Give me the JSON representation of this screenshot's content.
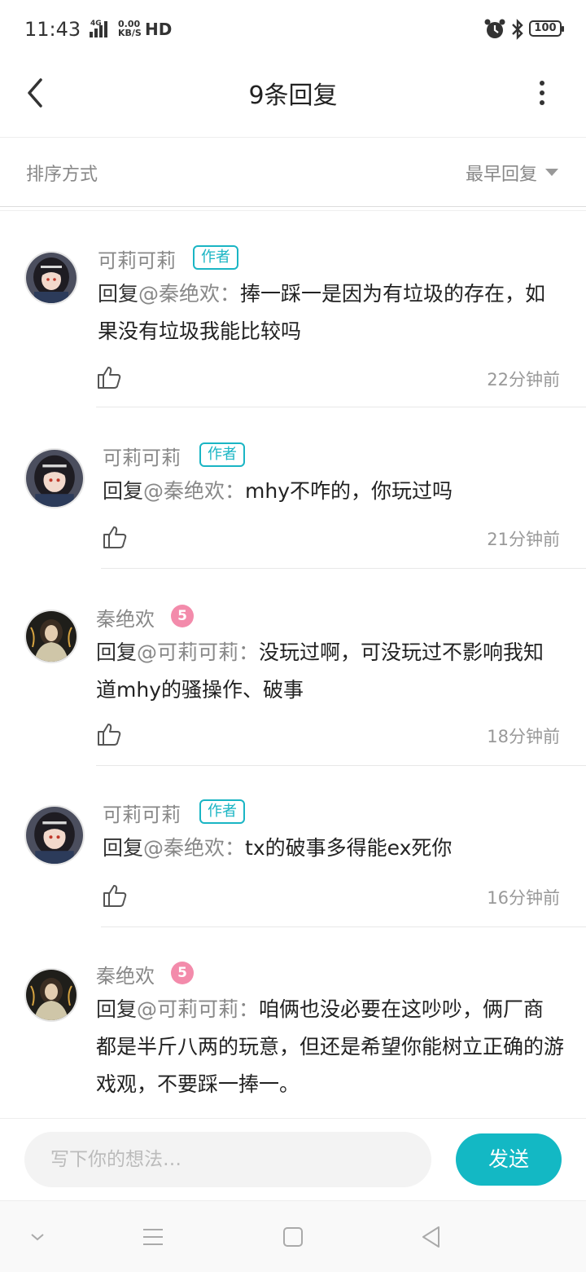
{
  "status_bar": {
    "time": "11:43",
    "network": "4G",
    "speed_top": "0.00",
    "speed_bottom": "KB/S",
    "hd": "HD",
    "battery": "100",
    "icons": [
      "signal-icon",
      "alarm-icon",
      "bluetooth-icon",
      "battery-icon"
    ]
  },
  "header": {
    "title": "9条回复",
    "back_icon": "back-arrow-icon",
    "more_icon": "more-vertical-icon"
  },
  "sort": {
    "label": "排序方式",
    "value": "最早回复"
  },
  "replies": [
    {
      "username": "可莉可莉",
      "badge": "作者",
      "prefix": "回复",
      "mention": "@秦绝欢",
      "colon": "：",
      "text": "捧一踩一是因为有垃圾的存在，如果没有垃圾我能比较吗",
      "time": "22分钟前"
    },
    {
      "username": "可莉可莉",
      "badge": "作者",
      "prefix": "回复",
      "mention": "@秦绝欢",
      "colon": "：",
      "text": "mhy不咋的，你玩过吗",
      "time": "21分钟前"
    },
    {
      "username": "秦绝欢",
      "level": "5",
      "prefix": "回复",
      "mention": "@可莉可莉",
      "colon": "：",
      "text": "没玩过啊，可没玩过不影响我知道mhy的骚操作、破事",
      "time": "18分钟前"
    },
    {
      "username": "可莉可莉",
      "badge": "作者",
      "prefix": "回复",
      "mention": "@秦绝欢",
      "colon": "：",
      "text": "tx的破事多得能ex死你",
      "time": "16分钟前"
    },
    {
      "username": "秦绝欢",
      "level": "5",
      "prefix": "回复",
      "mention": "@可莉可莉",
      "colon": "：",
      "text": "咱俩也没必要在这吵吵，俩厂商都是半斤八两的玩意，但还是希望你能树立正确的游戏观，不要踩一捧一。",
      "time": ""
    }
  ],
  "composer": {
    "placeholder": "写下你的想法…",
    "send_label": "发送"
  },
  "colors": {
    "accent": "#13b8c4",
    "level_badge": "#f38bab"
  },
  "nav_bar": {
    "icons": [
      "nav-collapse-icon",
      "nav-menu-icon",
      "nav-home-icon",
      "nav-back-icon"
    ]
  }
}
